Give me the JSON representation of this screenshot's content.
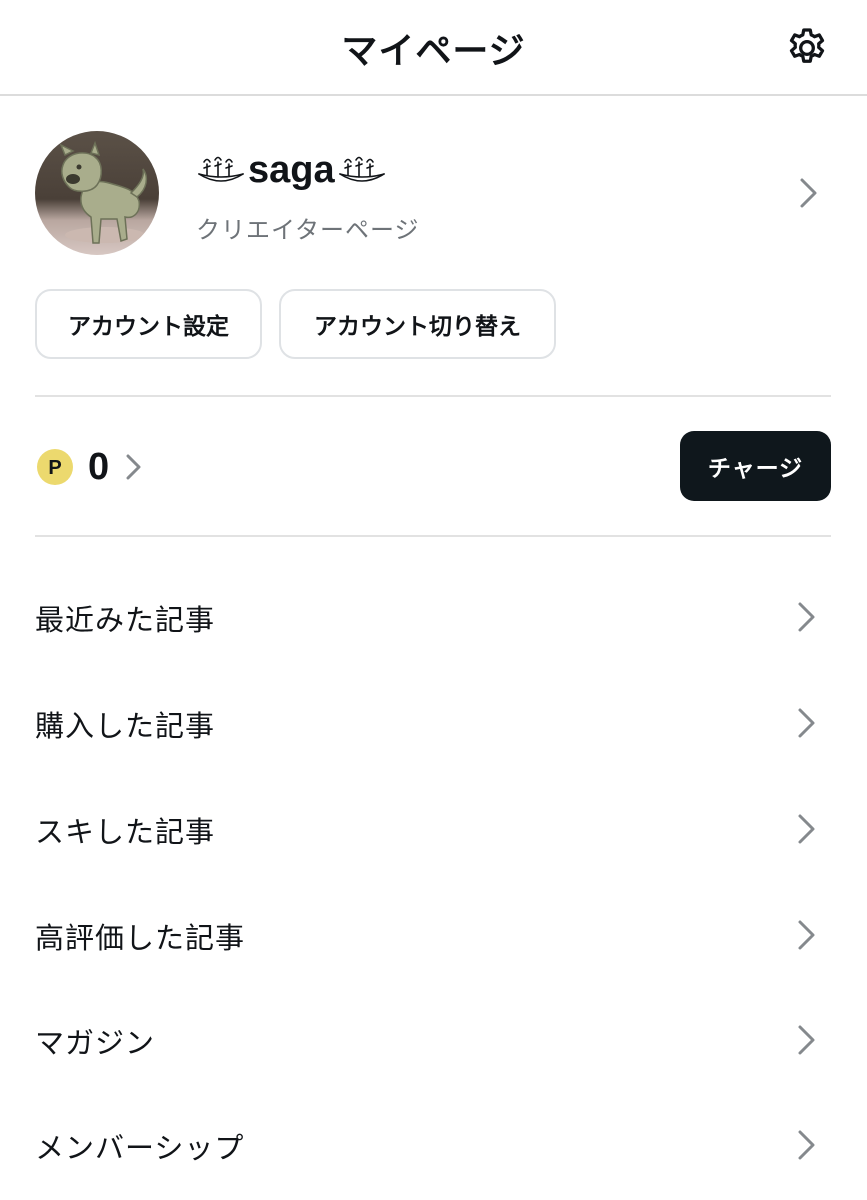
{
  "header": {
    "title": "マイページ",
    "settings_icon": "gear-icon"
  },
  "profile": {
    "username": "saga",
    "subtitle": "クリエイターページ",
    "avatar_icon": "avatar-photo",
    "name_decoration_icon": "bowl-of-figures-emoji"
  },
  "account_buttons": {
    "settings": "アカウント設定",
    "switch": "アカウント切り替え"
  },
  "points": {
    "icon": "p-coin-icon",
    "value": "0",
    "charge_label": "チャージ"
  },
  "menu": [
    {
      "label": "最近みた記事"
    },
    {
      "label": "購入した記事"
    },
    {
      "label": "スキした記事"
    },
    {
      "label": "高評価した記事"
    },
    {
      "label": "マガジン"
    },
    {
      "label": "メンバーシップ"
    }
  ],
  "colors": {
    "text": "#111418",
    "muted": "#6e7378",
    "charge_button": "#0f171c",
    "coin": "#ecd96e",
    "divider": "#e2e2e2",
    "chevron": "#85898d"
  }
}
